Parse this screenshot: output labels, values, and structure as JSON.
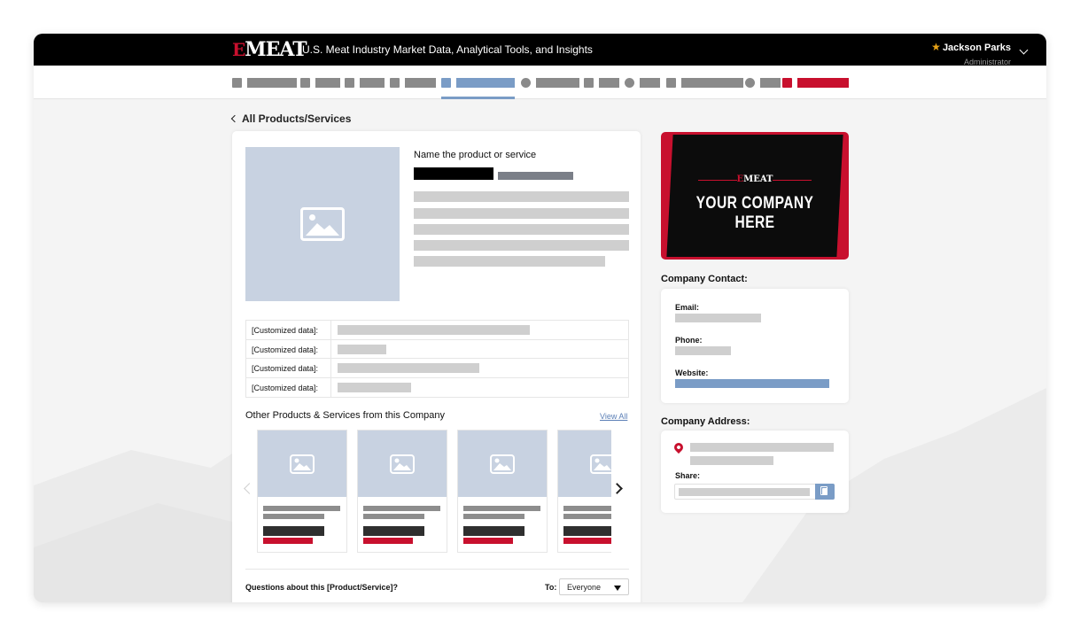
{
  "header": {
    "logo_text": "MEAT",
    "logo_prefix": "E",
    "tagline": "U.S. Meat Industry Market Data, Analytical Tools, and Insights",
    "user_name": "Jackson Parks",
    "user_role": "Administrator"
  },
  "nav": {
    "active_index": 4,
    "item_icons": [
      "dashboard-icon",
      "list-icon",
      "table-icon",
      "calendar-icon",
      "storefront-icon",
      "star-icon",
      "handshake-icon",
      "apple-icon",
      "users-icon",
      "help-icon",
      "megaphone-icon"
    ]
  },
  "page": {
    "back_label": "All Products/Services"
  },
  "product": {
    "title": "Name the product or service",
    "custom_fields": [
      {
        "label": "[Customized data]:"
      },
      {
        "label": "[Customized data]:"
      },
      {
        "label": "[Customized data]:"
      },
      {
        "label": "[Customized data]:"
      }
    ]
  },
  "others": {
    "title": "Other Products & Services from this Company",
    "view_all": "View All"
  },
  "questions": {
    "label": "Questions about this [Product/Service]?",
    "to_label": "To:",
    "recipient": "Everyone"
  },
  "ad": {
    "logo_prefix": "E",
    "logo_text": "MEAT",
    "text": "YOUR COMPANY HERE"
  },
  "contact": {
    "title": "Company Contact:",
    "email_label": "Email:",
    "phone_label": "Phone:",
    "website_label": "Website:"
  },
  "address": {
    "title": "Company Address:",
    "share_label": "Share:"
  },
  "colors": {
    "brand_red": "#c8102e",
    "accent_blue": "#7a9cc6",
    "topbar": "#000000"
  }
}
